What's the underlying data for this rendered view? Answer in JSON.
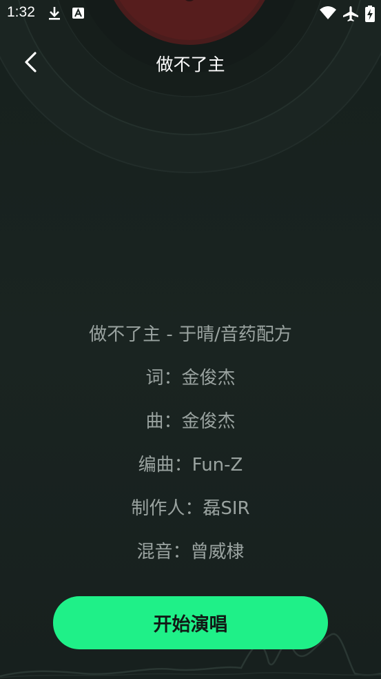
{
  "status_bar": {
    "time": "1:32",
    "icons": [
      "download-icon",
      "a-box-icon",
      "wifi-icon",
      "airplane-icon",
      "battery-charging-icon"
    ]
  },
  "header": {
    "title": "做不了主",
    "back_icon": "chevron-left-icon"
  },
  "song_info": {
    "lines": [
      "做不了主 - 于晴/音药配方",
      "词：金俊杰",
      "曲：金俊杰",
      "编曲：Fun-Z",
      "制作人：磊SIR",
      "混音：曾威棣"
    ]
  },
  "action": {
    "start_label": "开始演唱"
  },
  "colors": {
    "accent": "#1ff088",
    "background": "#17201e",
    "vinyl_center": "#5a1a1a",
    "text_muted": "#9aa3a0"
  }
}
